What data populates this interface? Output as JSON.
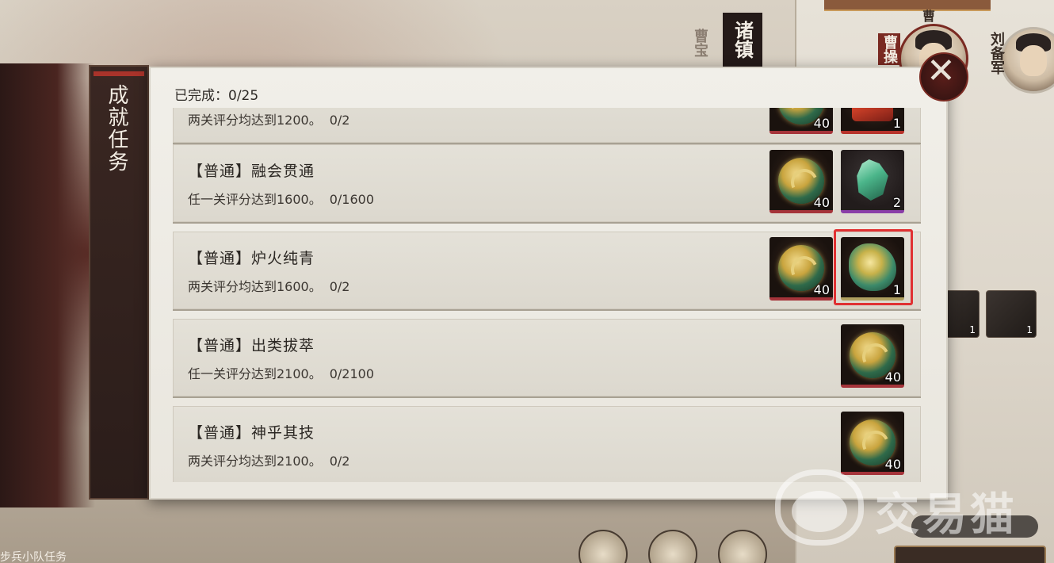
{
  "background": {
    "zhu_tab_label": "诸镇",
    "faded_vertical_label": "曹宝",
    "avatars": [
      {
        "label": "曹操",
        "name_tag": "曹"
      },
      {
        "label": "刘备军"
      }
    ],
    "mini_items": [
      {
        "qty": "1"
      },
      {
        "qty": "1"
      }
    ],
    "bottom_left_text": "步兵小队任务"
  },
  "dialog": {
    "side_tab_label": "成就任务",
    "completed_label": "已完成：0/25",
    "close_glyph": "✕",
    "tasks": [
      {
        "title": "",
        "desc": "两关评分均达到1200。",
        "progress": "0/2",
        "rewards": [
          {
            "type": "gold-coin",
            "qty": "40"
          },
          {
            "type": "red-item",
            "qty": "1"
          }
        ]
      },
      {
        "title": "【普通】融会贯通",
        "desc": "任一关评分达到1600。",
        "progress": "0/1600",
        "rewards": [
          {
            "type": "gold-coin",
            "qty": "40"
          },
          {
            "type": "jade-stone",
            "qty": "2"
          }
        ]
      },
      {
        "title": "【普通】炉火纯青",
        "desc": "两关评分均达到1600。",
        "progress": "0/2",
        "rewards": [
          {
            "type": "gold-coin",
            "qty": "40"
          },
          {
            "type": "jade-dragon",
            "qty": "1",
            "highlighted": true
          }
        ]
      },
      {
        "title": "【普通】出类拔萃",
        "desc": "任一关评分达到2100。",
        "progress": "0/2100",
        "rewards": [
          {
            "type": "gold-coin",
            "qty": "40"
          }
        ]
      },
      {
        "title": "【普通】神乎其技",
        "desc": "两关评分均达到2100。",
        "progress": "0/2",
        "rewards": [
          {
            "type": "gold-coin",
            "qty": "40"
          }
        ]
      }
    ]
  },
  "watermark": {
    "text": "交易猫"
  },
  "colors": {
    "highlight": "#e03032",
    "panel_bg": "#f1efe9",
    "task_bg": "#e4e1d8",
    "side_tab_bg": "#3a2722"
  }
}
